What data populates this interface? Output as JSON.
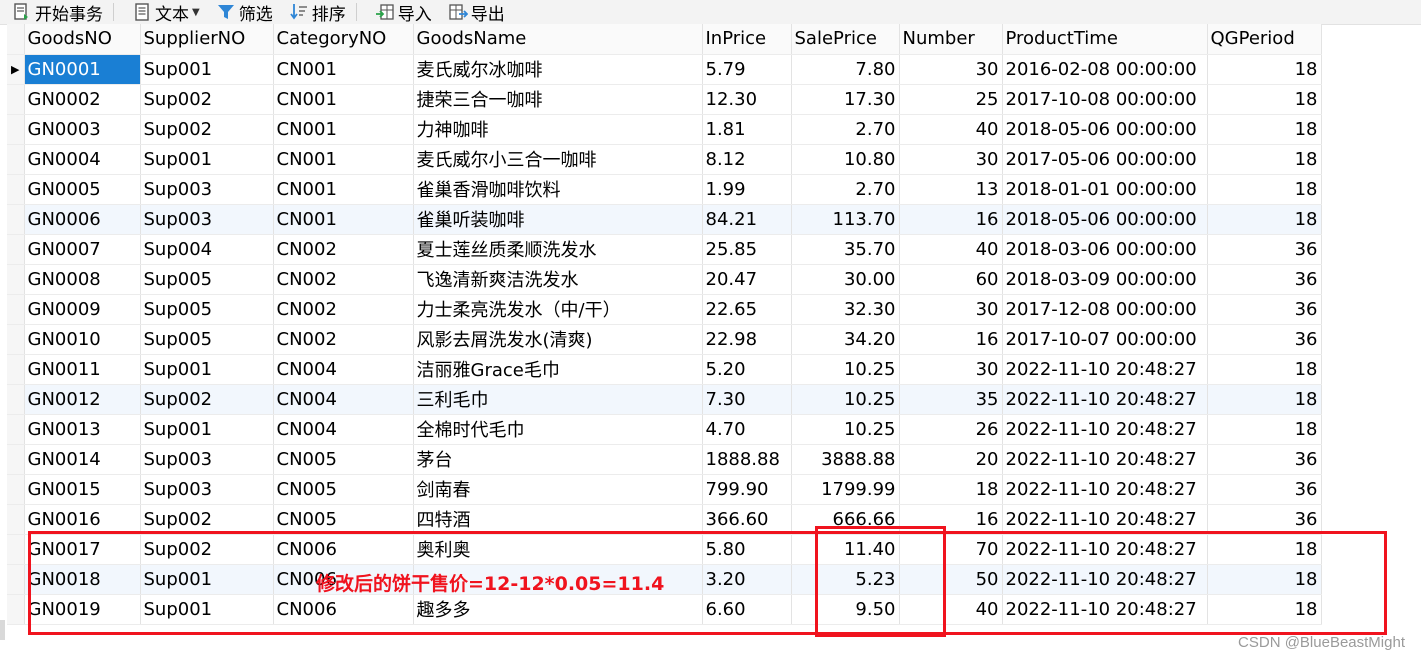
{
  "toolbar": {
    "begin_transaction": "开始事务",
    "text": "文本",
    "filter": "筛选",
    "sort": "排序",
    "import": "导入",
    "export": "导出"
  },
  "grid": {
    "columns": [
      "GoodsNO",
      "SupplierNO",
      "CategoryNO",
      "GoodsName",
      "InPrice",
      "SalePrice",
      "Number",
      "ProductTime",
      "QGPeriod"
    ],
    "rows": [
      [
        "GN0001",
        "Sup001",
        "CN001",
        "麦氏威尔冰咖啡",
        "5.79",
        "7.80",
        "30",
        "2016-02-08 00:00:00",
        "18"
      ],
      [
        "GN0002",
        "Sup002",
        "CN001",
        "捷荣三合一咖啡",
        "12.30",
        "17.30",
        "25",
        "2017-10-08 00:00:00",
        "18"
      ],
      [
        "GN0003",
        "Sup002",
        "CN001",
        "力神咖啡",
        "1.81",
        "2.70",
        "40",
        "2018-05-06 00:00:00",
        "18"
      ],
      [
        "GN0004",
        "Sup001",
        "CN001",
        "麦氏威尔小三合一咖啡",
        "8.12",
        "10.80",
        "30",
        "2017-05-06 00:00:00",
        "18"
      ],
      [
        "GN0005",
        "Sup003",
        "CN001",
        "雀巢香滑咖啡饮料",
        "1.99",
        "2.70",
        "13",
        "2018-01-01 00:00:00",
        "18"
      ],
      [
        "GN0006",
        "Sup003",
        "CN001",
        "雀巢听装咖啡",
        "84.21",
        "113.70",
        "16",
        "2018-05-06 00:00:00",
        "18"
      ],
      [
        "GN0007",
        "Sup004",
        "CN002",
        "夏士莲丝质柔顺洗发水",
        "25.85",
        "35.70",
        "40",
        "2018-03-06 00:00:00",
        "36"
      ],
      [
        "GN0008",
        "Sup005",
        "CN002",
        "飞逸清新爽洁洗发水",
        "20.47",
        "30.00",
        "60",
        "2018-03-09 00:00:00",
        "36"
      ],
      [
        "GN0009",
        "Sup005",
        "CN002",
        "力士柔亮洗发水（中/干）",
        "22.65",
        "32.30",
        "30",
        "2017-12-08 00:00:00",
        "36"
      ],
      [
        "GN0010",
        "Sup005",
        "CN002",
        "风影去屑洗发水(清爽)",
        "22.98",
        "34.20",
        "16",
        "2017-10-07 00:00:00",
        "36"
      ],
      [
        "GN0011",
        "Sup001",
        "CN004",
        "洁丽雅Grace毛巾",
        "5.20",
        "10.25",
        "30",
        "2022-11-10 20:48:27",
        "18"
      ],
      [
        "GN0012",
        "Sup002",
        "CN004",
        "三利毛巾",
        "7.30",
        "10.25",
        "35",
        "2022-11-10 20:48:27",
        "18"
      ],
      [
        "GN0013",
        "Sup001",
        "CN004",
        "全棉时代毛巾",
        "4.70",
        "10.25",
        "26",
        "2022-11-10 20:48:27",
        "18"
      ],
      [
        "GN0014",
        "Sup003",
        "CN005",
        "茅台",
        "1888.88",
        "3888.88",
        "20",
        "2022-11-10 20:48:27",
        "36"
      ],
      [
        "GN0015",
        "Sup003",
        "CN005",
        "剑南春",
        "799.90",
        "1799.99",
        "18",
        "2022-11-10 20:48:27",
        "36"
      ],
      [
        "GN0016",
        "Sup002",
        "CN005",
        "四特酒",
        "366.60",
        "666.66",
        "16",
        "2022-11-10 20:48:27",
        "36"
      ],
      [
        "GN0017",
        "Sup002",
        "CN006",
        "奥利奥",
        "5.80",
        "11.40",
        "70",
        "2022-11-10 20:48:27",
        "18"
      ],
      [
        "GN0018",
        "Sup001",
        "CN006",
        "",
        "3.20",
        "5.23",
        "50",
        "2022-11-10 20:48:27",
        "18"
      ],
      [
        "GN0019",
        "Sup001",
        "CN006",
        "趣多多",
        "6.60",
        "9.50",
        "40",
        "2022-11-10 20:48:27",
        "18"
      ]
    ],
    "alt_rows": [
      5,
      11,
      17
    ],
    "selected_cell": {
      "row": 0,
      "col": 0
    }
  },
  "annotation": {
    "text": "修改后的饼干售价=12-12*0.05=11.4"
  },
  "watermark": "CSDN @BlueBeastMight",
  "colors": {
    "annotation": "#f0131e",
    "selection": "#1a7fd4",
    "alt_row": "#f2f7fd"
  }
}
